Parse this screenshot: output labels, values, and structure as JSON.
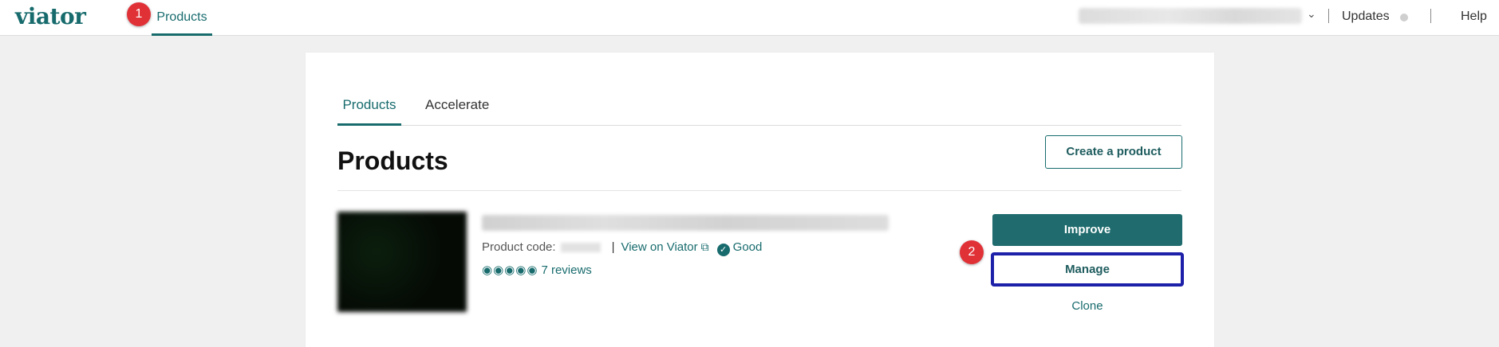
{
  "brand": {
    "logo": "viator",
    "accent": "#186b6d"
  },
  "topnav": {
    "products_label": "Products",
    "updates_label": "Updates",
    "help_label": "Help"
  },
  "annotations": {
    "badge1": "1",
    "badge2": "2"
  },
  "card": {
    "tabs": [
      {
        "label": "Products"
      },
      {
        "label": "Accelerate"
      }
    ],
    "page_title": "Products",
    "create_button": "Create a product"
  },
  "product": {
    "code_label": "Product code:",
    "view_link": "View on Viator",
    "status": "Good",
    "rating_stars": "◉◉◉◉◉",
    "reviews_label": "7 reviews",
    "improve_label": "Improve",
    "manage_label": "Manage",
    "clone_label": "Clone"
  }
}
